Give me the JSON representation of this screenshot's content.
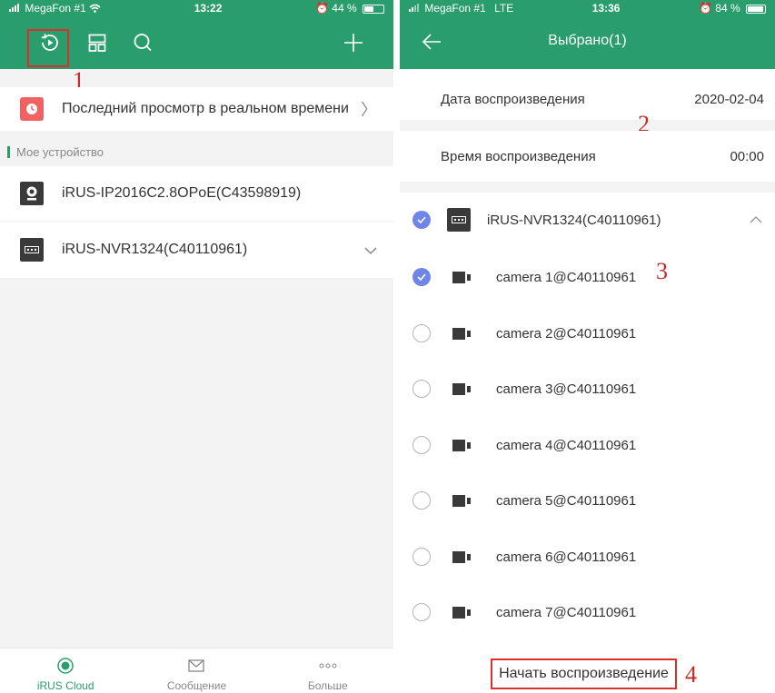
{
  "left": {
    "status": {
      "carrier": "MegaFon #1",
      "time": "13:22",
      "battery": "44 %"
    },
    "nav": {
      "icons": [
        "playback-icon",
        "layout-icon",
        "search-icon",
        "add-icon"
      ]
    },
    "recent": {
      "label": "Последний просмотр в реальном времени"
    },
    "section": "Мое устройство",
    "devices": [
      {
        "name": "iRUS-IP2016C2.8OPoE(C43598919)",
        "icon": "camera-device-icon"
      },
      {
        "name": "iRUS-NVR1324(C40110961)",
        "icon": "nvr-device-icon"
      }
    ],
    "tabs": [
      {
        "label": "iRUS Cloud",
        "icon": "cloud-icon"
      },
      {
        "label": "Сообщение",
        "icon": "envelope-icon"
      },
      {
        "label": "Больше",
        "icon": "more-icon"
      }
    ]
  },
  "right": {
    "status": {
      "carrier": "MegaFon #1",
      "network": "LTE",
      "time": "13:36",
      "battery": "84 %"
    },
    "nav": {
      "title": "Выбрано(1)"
    },
    "playback_date": {
      "label": "Дата воспроизведения",
      "value": "2020-02-04"
    },
    "playback_time": {
      "label": "Время воспроизведения",
      "value": "00:00"
    },
    "nvr": {
      "name": "iRUS-NVR1324(C40110961)",
      "checked": true
    },
    "cameras": [
      {
        "name": "camera 1@C40110961",
        "checked": true
      },
      {
        "name": "camera 2@C40110961",
        "checked": false
      },
      {
        "name": "camera 3@C40110961",
        "checked": false
      },
      {
        "name": "camera 4@C40110961",
        "checked": false
      },
      {
        "name": "camera 5@C40110961",
        "checked": false
      },
      {
        "name": "camera 6@C40110961",
        "checked": false
      },
      {
        "name": "camera 7@C40110961",
        "checked": false
      }
    ],
    "start_button": "Начать воспроизведение"
  },
  "annotations": [
    "1",
    "2",
    "3",
    "4"
  ],
  "colors": {
    "accent": "#2a9d6c",
    "highlight": "#d9322c",
    "check": "#6f86e8"
  }
}
